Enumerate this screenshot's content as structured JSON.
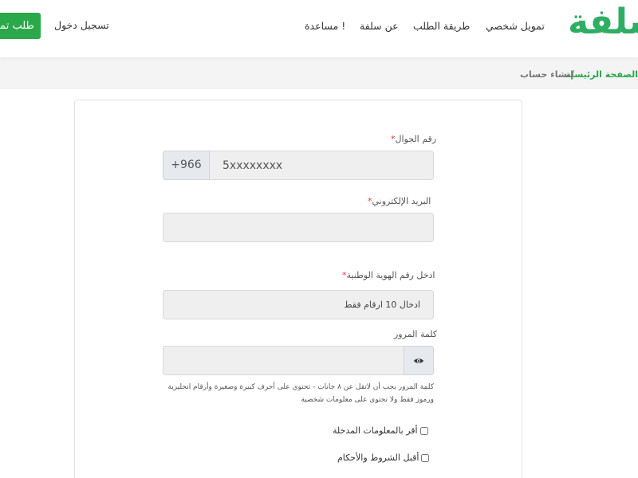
{
  "header": {
    "logo": "سلفة",
    "nav": [
      "تمويل شخصي",
      "طريقة الطلب",
      "عن سلفة",
      "مساعدة !"
    ],
    "login": "تسجيل دخول",
    "apply_button": "طلب تمويل"
  },
  "breadcrumb": {
    "home": "الصفحة الرئيسية",
    "separator": "/",
    "current": "إنشاء حساب"
  },
  "form": {
    "phone": {
      "label": "رقم الجوال",
      "prefix": "+966",
      "placeholder": "5xxxxxxxx"
    },
    "email": {
      "label": "البريد الإلكتروني",
      "placeholder": ""
    },
    "national_id": {
      "label": "ادخل رقم الهوية الوطنية",
      "placeholder": "ادخال 10 ارقام فقط"
    },
    "password": {
      "label": "كلمة المرور",
      "hint": "كلمة المرور يجب أن لاتقل عن ٨ خانات - تحتوي على أحرف كبيرة وصغيرة وأرقام انجليزية ورموز فقط ولا تحتوى على معلومات شخصية"
    },
    "required_mark": "*",
    "checkbox_confirm": "أقر بالمعلومات المدخلة",
    "checkbox_terms": "أقبل الشروط والأحكام"
  },
  "colors": {
    "brand_green": "#2aa84a",
    "logo_green": "#2fae63",
    "required_red": "#ee3333"
  },
  "icons": {
    "password_toggle": "eye-icon"
  }
}
